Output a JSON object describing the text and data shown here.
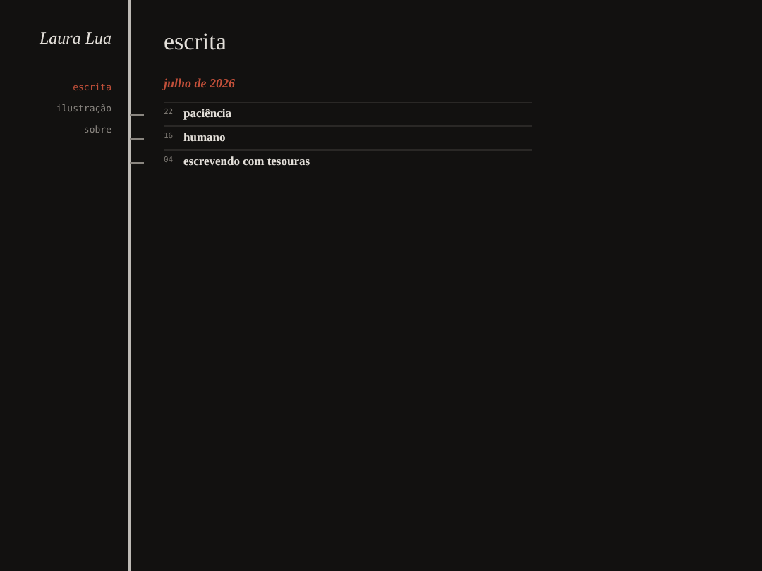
{
  "site_title": "Laura Lua",
  "nav": [
    {
      "label": "escrita",
      "selected": true
    },
    {
      "label": "ilustração",
      "selected": false
    },
    {
      "label": "sobre",
      "selected": false
    }
  ],
  "page_title": "escrita",
  "groups": [
    {
      "heading": "julho de 2026",
      "posts": [
        {
          "day": "22",
          "title": "paciência"
        },
        {
          "day": "16",
          "title": "humano"
        },
        {
          "day": "04",
          "title": "escrevendo com tesouras"
        }
      ]
    }
  ]
}
